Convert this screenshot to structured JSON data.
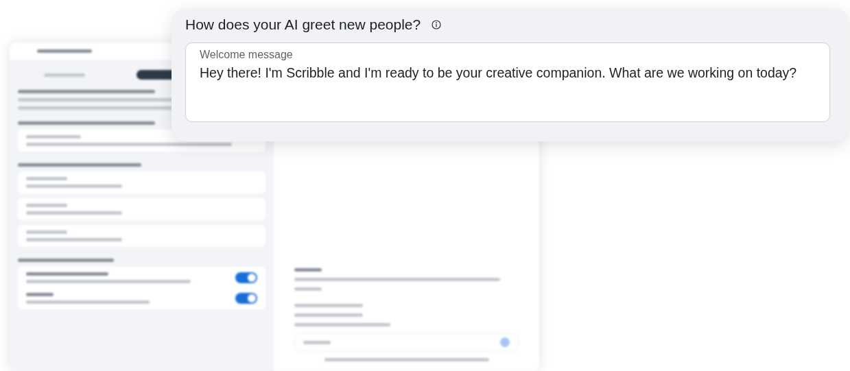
{
  "dialog": {
    "title": "How does your AI greet new people?",
    "field": {
      "label": "Welcome message",
      "value": "Hey there! I'm Scribble and I'm ready to be your creative companion. What are we working on today?"
    }
  }
}
